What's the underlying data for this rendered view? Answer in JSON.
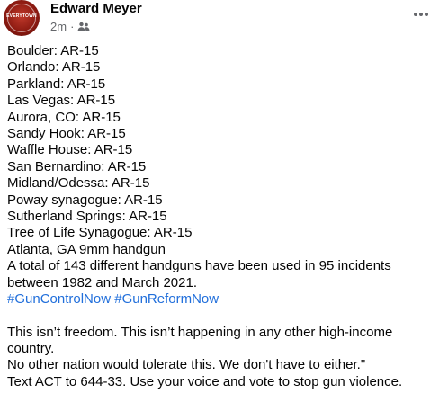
{
  "post": {
    "author": "Edward Meyer",
    "timestamp": "2m",
    "separator": "·",
    "audience_icon": "friends-icon",
    "more_icon": "more-horizontal-icon",
    "avatar_text": "EVERYTOWN"
  },
  "body": {
    "lines": [
      "Boulder: AR-15",
      "Orlando: AR-15",
      "Parkland: AR-15",
      "Las Vegas: AR-15",
      "Aurora, CO: AR-15",
      "Sandy Hook: AR-15",
      "Waffle House: AR-15",
      "San Bernardino: AR-15",
      "Midland/Odessa: AR-15",
      "Poway synagogue: AR-15",
      "Sutherland Springs: AR-15",
      "Tree of Life Synagogue: AR-15",
      "Atlanta, GA 9mm handgun",
      "A total of 143 different handguns have been used in 95 incidents",
      "between 1982 and March 2021."
    ],
    "hashtags": [
      "#GunControlNow",
      "#GunReformNow"
    ],
    "closing_lines": [
      "This isn’t freedom. This isn’t happening in any other high-income",
      "country.",
      "No other nation would tolerate this. We don't have to either.\"",
      "Text ACT to 644-33. Use your voice and vote to stop gun violence."
    ]
  },
  "colors": {
    "text": "#050505",
    "secondary": "#65676b",
    "hashtag": "#216fdb",
    "background": "#ffffff"
  }
}
